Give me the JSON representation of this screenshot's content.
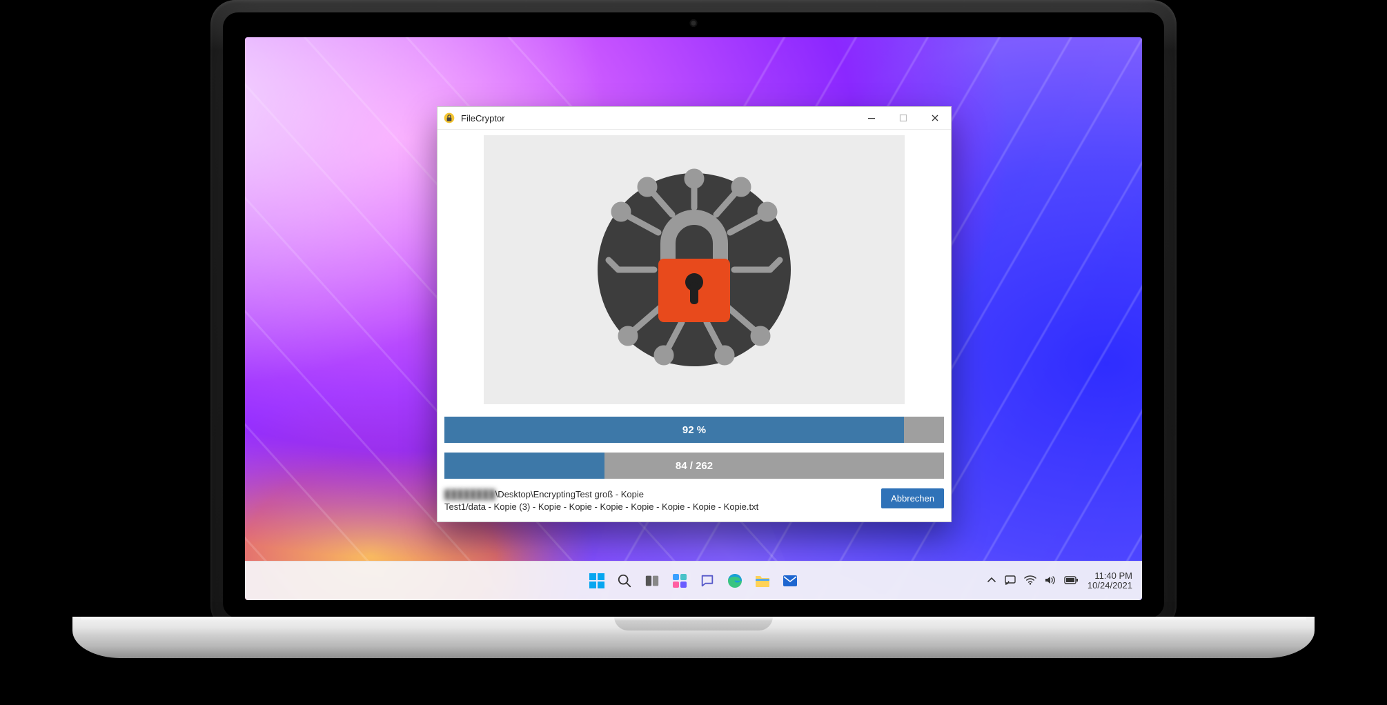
{
  "app": {
    "title": "FileCryptor",
    "iconName": "lock-app-icon"
  },
  "windowControls": {
    "minimize": "minimize",
    "maximize": "maximize",
    "close": "close",
    "maximizeDisabled": true
  },
  "progress1": {
    "percent": 92,
    "label": "92 %"
  },
  "progress2": {
    "current": 84,
    "total": 262,
    "percent": 32,
    "label": "84 / 262"
  },
  "status": {
    "obscuredPrefix": "████████",
    "line1Suffix": "\\Desktop\\EncryptingTest groß - Kopie",
    "line2": "Test1/data - Kopie (3) - Kopie - Kopie - Kopie - Kopie - Kopie - Kopie - Kopie.txt"
  },
  "buttons": {
    "cancel": "Abbrechen"
  },
  "taskbar": {
    "items": [
      {
        "name": "start",
        "icon": "windows-icon"
      },
      {
        "name": "search",
        "icon": "search-icon"
      },
      {
        "name": "task-view",
        "icon": "taskview-icon"
      },
      {
        "name": "widgets",
        "icon": "widgets-icon"
      },
      {
        "name": "chat",
        "icon": "chat-icon"
      },
      {
        "name": "edge",
        "icon": "edge-icon"
      },
      {
        "name": "explorer",
        "icon": "explorer-icon"
      },
      {
        "name": "mail",
        "icon": "mail-icon"
      }
    ]
  },
  "tray": {
    "icons": [
      "chevron-up-icon",
      "cast-icon",
      "wifi-icon",
      "volume-icon",
      "battery-icon"
    ],
    "time": "11:40 PM",
    "date": "10/24/2021"
  },
  "colors": {
    "progressFill": "#3d78a8",
    "progressTrack": "#9f9f9f",
    "accentButton": "#2f72b8"
  }
}
